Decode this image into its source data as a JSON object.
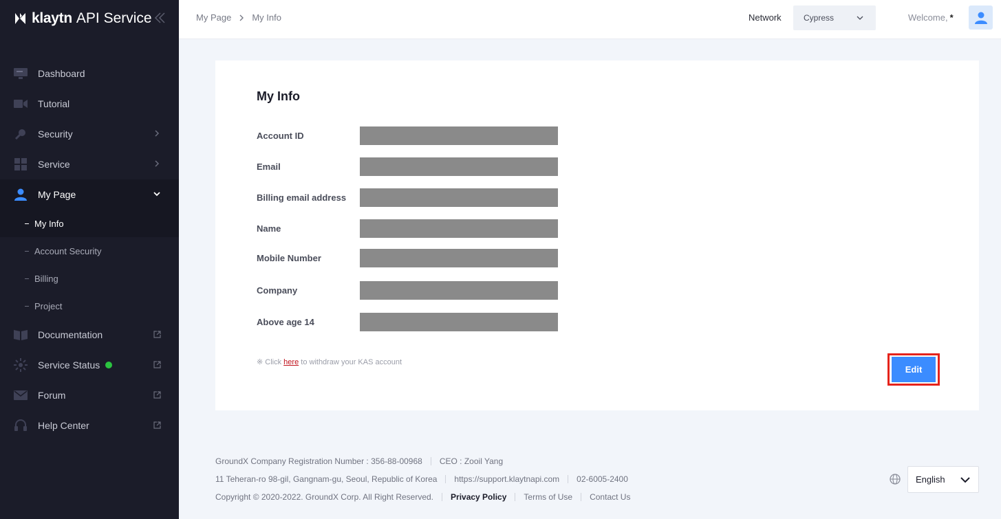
{
  "brand": {
    "name": "klaytn",
    "service": "API Service"
  },
  "sidebar": {
    "items": [
      {
        "label": "Dashboard",
        "icon": "dashboard-icon"
      },
      {
        "label": "Tutorial",
        "icon": "video-icon"
      },
      {
        "label": "Security",
        "icon": "key-icon"
      },
      {
        "label": "Service",
        "icon": "grid-icon"
      },
      {
        "label": "My Page",
        "icon": "user-icon"
      },
      {
        "label": "Documentation",
        "icon": "book-icon"
      },
      {
        "label": "Service Status",
        "icon": "status-icon"
      },
      {
        "label": "Forum",
        "icon": "mail-icon"
      },
      {
        "label": "Help Center",
        "icon": "headset-icon"
      }
    ],
    "subitems": [
      {
        "label": "My Info"
      },
      {
        "label": "Account Security"
      },
      {
        "label": "Billing"
      },
      {
        "label": "Project"
      }
    ]
  },
  "header": {
    "breadcrumb": [
      "My Page",
      "My Info"
    ],
    "network_label": "Network",
    "network_value": "Cypress",
    "welcome": "Welcome,",
    "user": "*"
  },
  "main": {
    "title": "My Info",
    "fields": [
      {
        "label": "Account ID"
      },
      {
        "label": "Email"
      },
      {
        "label": "Billing email address"
      },
      {
        "label": "Name"
      },
      {
        "label": "Mobile Number"
      },
      {
        "label": "Company"
      },
      {
        "label": "Above age 14"
      }
    ],
    "withdraw_prefix": "※ Click",
    "withdraw_link": "here",
    "withdraw_suffix": "to withdraw your KAS account",
    "edit_label": "Edit"
  },
  "footer": {
    "reg": "GroundX Company Registration Number : 356-88-00968",
    "ceo": "CEO : Zooil Yang",
    "address": "11 Teheran-ro 98-gil, Gangnam-gu, Seoul, Republic of Korea",
    "support": "https://support.klaytnapi.com",
    "phone": "02-6005-2400",
    "copyright": "Copyright © 2020-2022. GroundX Corp. All Right Reserved.",
    "privacy": "Privacy Policy",
    "terms": "Terms of Use",
    "contact": "Contact Us",
    "language": "English"
  },
  "colors": {
    "accent": "#3b8cff",
    "sidebar_bg": "#1b1c29",
    "status_ok": "#2bc340",
    "highlight": "#e5231b"
  }
}
